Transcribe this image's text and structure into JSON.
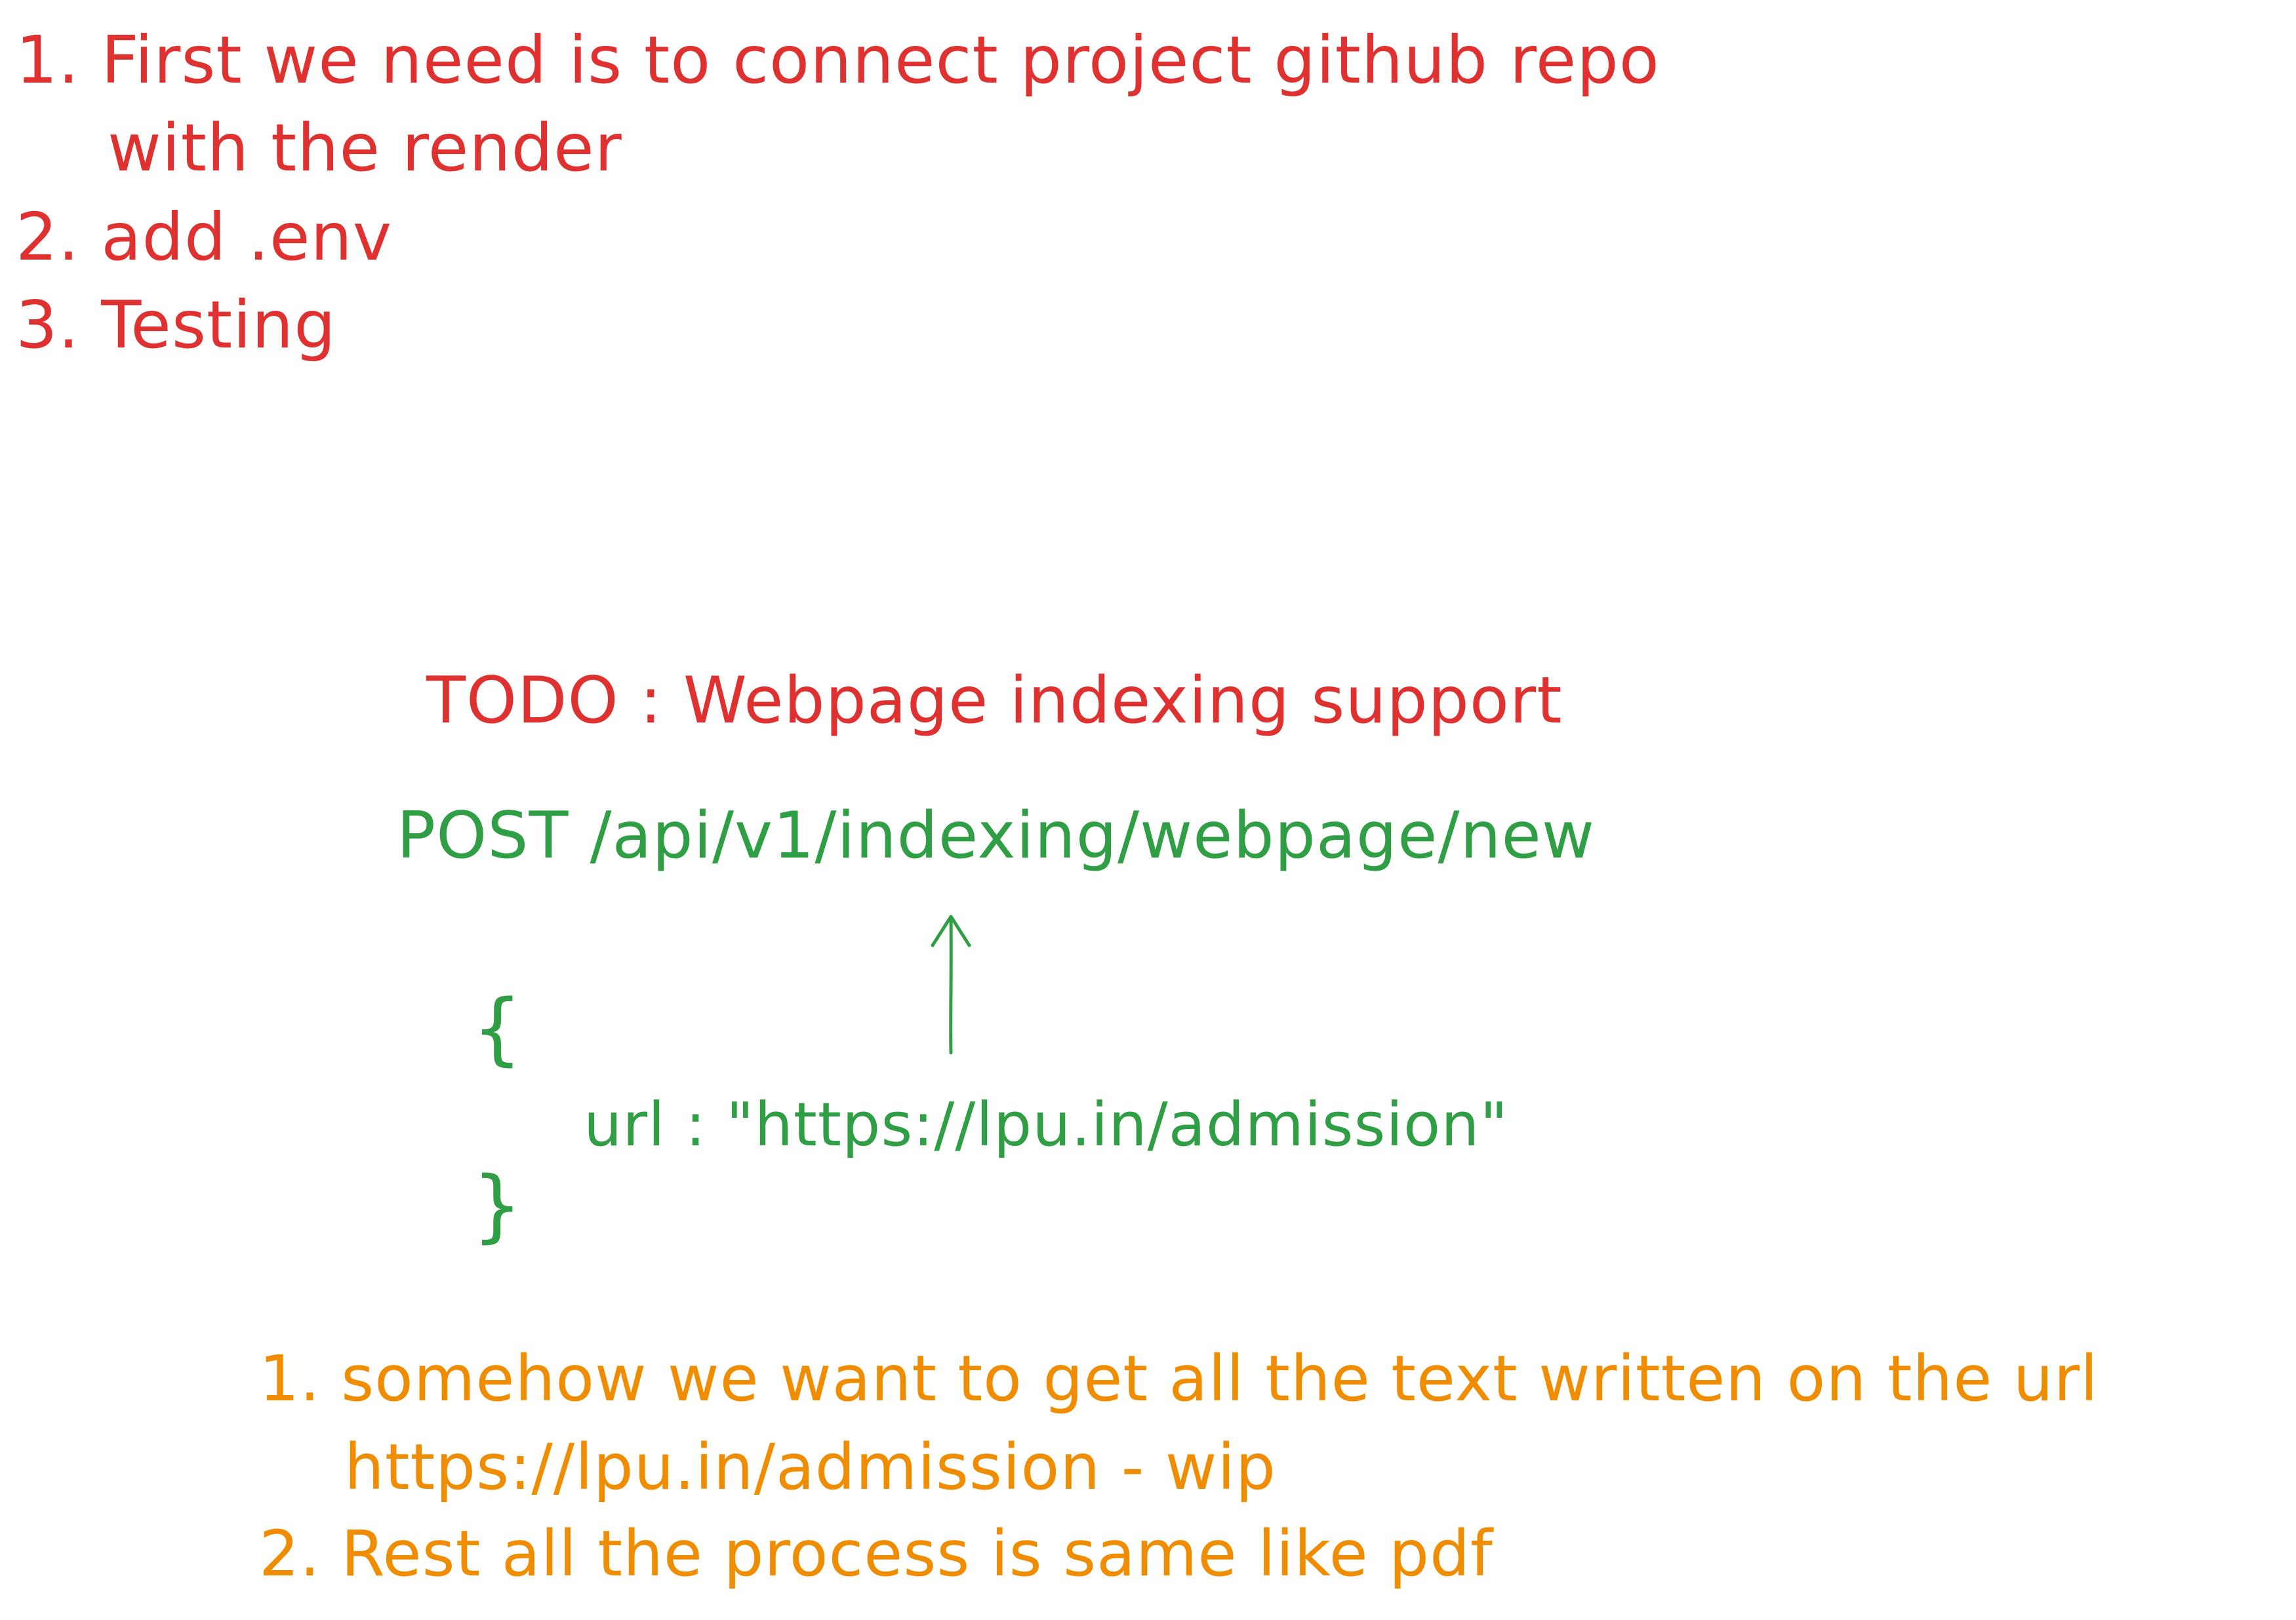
{
  "colors": {
    "red": "#e03131",
    "green": "#2f9e44",
    "orange": "#f08c00"
  },
  "setup_steps": {
    "line_1": "1. First we need is to connect project github repo",
    "line_2": "with the render",
    "line_3": "2. add .env",
    "line_4": "3. Testing"
  },
  "todo": {
    "title": "TODO : Webpage indexing support"
  },
  "api": {
    "endpoint": "POST /api/v1/indexing/webpage/new",
    "brace_open": "{",
    "body_line": "url : \"https://lpu.in/admission\"",
    "brace_close": "}"
  },
  "notes": {
    "line_1": "1. somehow we want to get all the text written on the url",
    "line_2": "https://lpu.in/admission - wip",
    "line_3": "2. Rest all the process is same like pdf"
  },
  "arrow": {
    "icon": "arrow-up-icon",
    "direction": "up"
  }
}
